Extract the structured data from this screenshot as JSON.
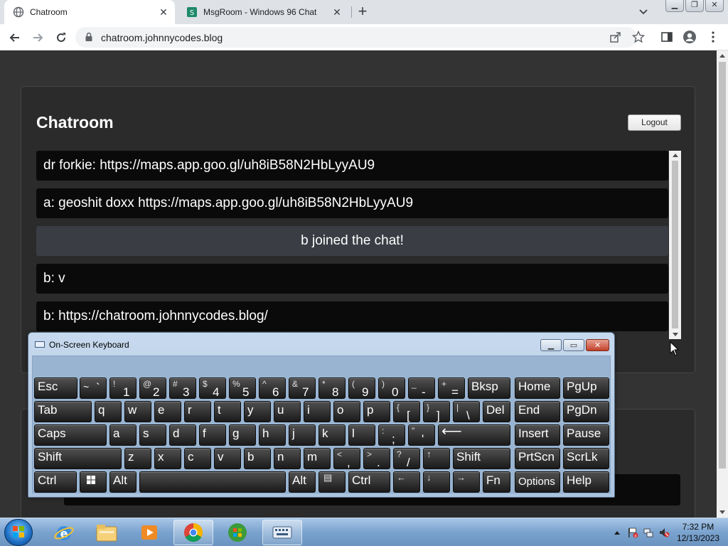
{
  "browser": {
    "tabs": [
      {
        "label": "Chatroom",
        "active": true
      },
      {
        "label": "MsgRoom - Windows 96 Chat",
        "active": false
      }
    ],
    "url": "chatroom.johnnycodes.blog"
  },
  "page": {
    "title": "Chatroom",
    "logout_label": "Logout",
    "messages": [
      {
        "text": "dr forkie: https://maps.app.goo.gl/uh8iB58N2HbLyyAU9",
        "type": "user"
      },
      {
        "text": "a: geoshit doxx https://maps.app.goo.gl/uh8iB58N2HbLyyAU9",
        "type": "user"
      },
      {
        "text": "b joined the chat!",
        "type": "system"
      },
      {
        "text": "b: v",
        "type": "user"
      },
      {
        "text": "b: https://chatroom.johnnycodes.blog/",
        "type": "user"
      }
    ]
  },
  "osk": {
    "title": "On-Screen Keyboard",
    "keys": {
      "esc": "Esc",
      "tilde_top": "~",
      "tilde_bot": "`",
      "n1_top": "!",
      "n1": "1",
      "n2_top": "@",
      "n2": "2",
      "n3_top": "#",
      "n3": "3",
      "n4_top": "$",
      "n4": "4",
      "n5_top": "%",
      "n5": "5",
      "n6_top": "^",
      "n6": "6",
      "n7_top": "&",
      "n7": "7",
      "n8_top": "*",
      "n8": "8",
      "n9_top": "(",
      "n9": "9",
      "n0_top": ")",
      "n0": "0",
      "minus_top": "_",
      "minus": "-",
      "eq_top": "+",
      "eq": "=",
      "bksp": "Bksp",
      "home": "Home",
      "pgup": "PgUp",
      "tab": "Tab",
      "q": "q",
      "w": "w",
      "e": "e",
      "r": "r",
      "t": "t",
      "y": "y",
      "u": "u",
      "i": "i",
      "o": "o",
      "p": "p",
      "lbr_top": "{",
      "lbr": "[",
      "rbr_top": "}",
      "rbr": "]",
      "bsl_top": "|",
      "bsl": "\\",
      "del": "Del",
      "end": "End",
      "pgdn": "PgDn",
      "caps": "Caps",
      "a": "a",
      "s": "s",
      "d": "d",
      "f": "f",
      "g": "g",
      "h": "h",
      "j": "j",
      "k": "k",
      "l": "l",
      "semi_top": ":",
      "semi": ";",
      "quote_top": "\"",
      "quote": "'",
      "enter": "⟵",
      "insert": "Insert",
      "pause": "Pause",
      "shift": "Shift",
      "z": "z",
      "x": "x",
      "c": "c",
      "v": "v",
      "b": "b",
      "n": "n",
      "m": "m",
      "comma_top": "<",
      "comma": ",",
      "period_top": ">",
      "period": ".",
      "slash_top": "?",
      "slash": "/",
      "up": "↑",
      "shift_r": "Shift",
      "prtscn": "PrtScn",
      "scrlk": "ScrLk",
      "ctrl": "Ctrl",
      "alt": "Alt",
      "alt_r": "Alt",
      "menu": "▤",
      "ctrl_r": "Ctrl",
      "left": "←",
      "down": "↓",
      "right": "→",
      "fn": "Fn",
      "options": "Options",
      "help": "Help"
    }
  },
  "taskbar": {
    "time": "7:32 PM",
    "date": "12/13/2023"
  },
  "colors": {
    "page_bg": "#333333",
    "card_bg": "#2b2b2b",
    "message_bg": "#0a0a0a",
    "system_message_bg": "#3a3d44",
    "keyboard_frame": "#a9c3df"
  }
}
